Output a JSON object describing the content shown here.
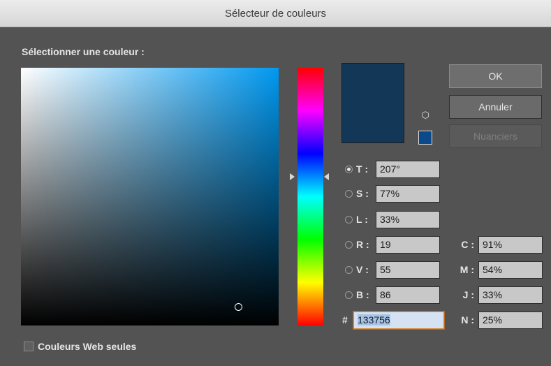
{
  "window": {
    "title": "Sélecteur de couleurs"
  },
  "picker": {
    "label": "Sélectionner une couleur :",
    "field_hue_color": "#0098f0"
  },
  "preview": {
    "current_color": "#133756",
    "web_safe_color": "#0b4a8a"
  },
  "buttons": {
    "ok": "OK",
    "cancel": "Annuler",
    "swatches": "Nuanciers"
  },
  "hsb": [
    {
      "label": "T :",
      "value": "207°",
      "selected": true
    },
    {
      "label": "S :",
      "value": "77%",
      "selected": false
    },
    {
      "label": "L :",
      "value": "33%",
      "selected": false
    }
  ],
  "rgb": [
    {
      "label": "R :",
      "value": "19"
    },
    {
      "label": "V :",
      "value": "55"
    },
    {
      "label": "B :",
      "value": "86"
    }
  ],
  "cmyk": [
    {
      "label": "C :",
      "value": "91%"
    },
    {
      "label": "M :",
      "value": "54%"
    },
    {
      "label": "J :",
      "value": "33%"
    },
    {
      "label": "N :",
      "value": "25%"
    }
  ],
  "hex": {
    "prefix": "#",
    "value": "133756"
  },
  "web_only": {
    "label": "Couleurs Web seules",
    "checked": false
  }
}
